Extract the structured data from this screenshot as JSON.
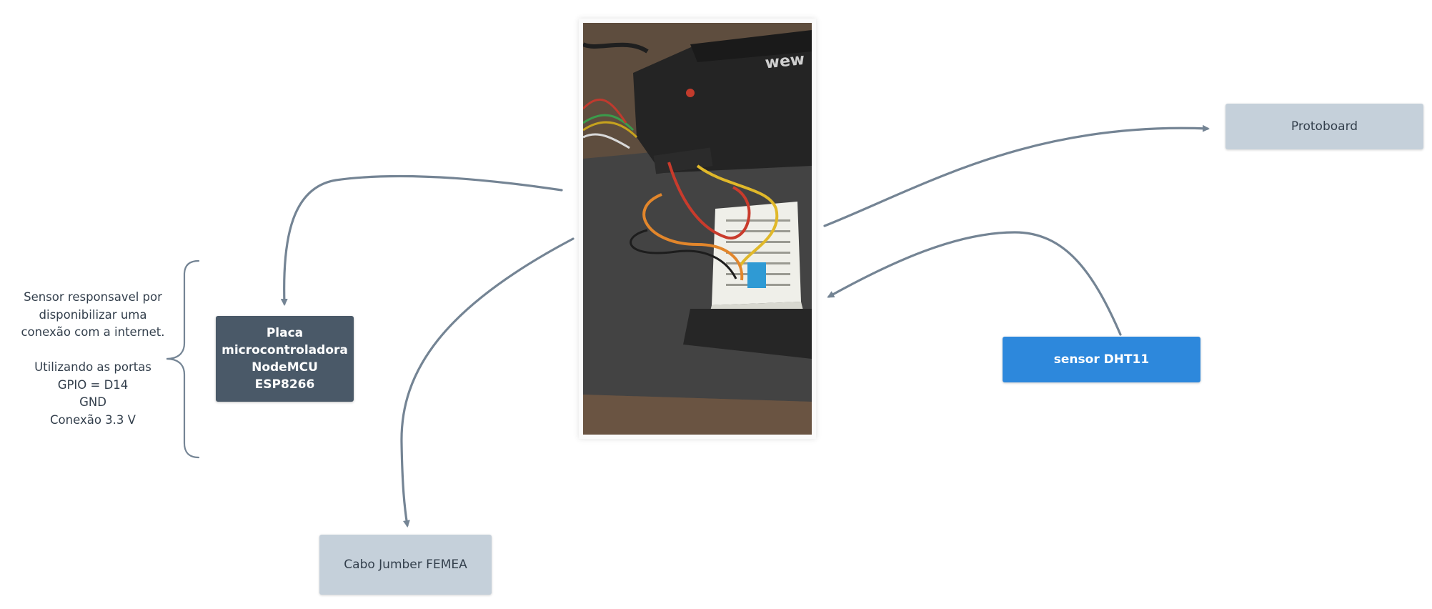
{
  "nodes": {
    "nodemcu": {
      "label": "Placa microcontroladora NodeMCU ESP8266"
    },
    "protoboard": {
      "label": "Protoboard"
    },
    "dht11": {
      "label": "sensor DHT11"
    },
    "cabo": {
      "label": "Cabo Jumber FEMEA"
    }
  },
  "annotation": {
    "lines": [
      "Sensor responsavel por",
      "disponibilizar uma",
      "conexão com a internet.",
      "",
      "Utilizando as portas",
      "GPIO = D14",
      "GND",
      "Conexão 3.3 V"
    ]
  },
  "photo": {
    "brand_text": "wew"
  },
  "colors": {
    "connector": "#748494",
    "node_dark": "#4a5968",
    "node_light": "#c5d0da",
    "node_blue": "#2d88dc"
  }
}
